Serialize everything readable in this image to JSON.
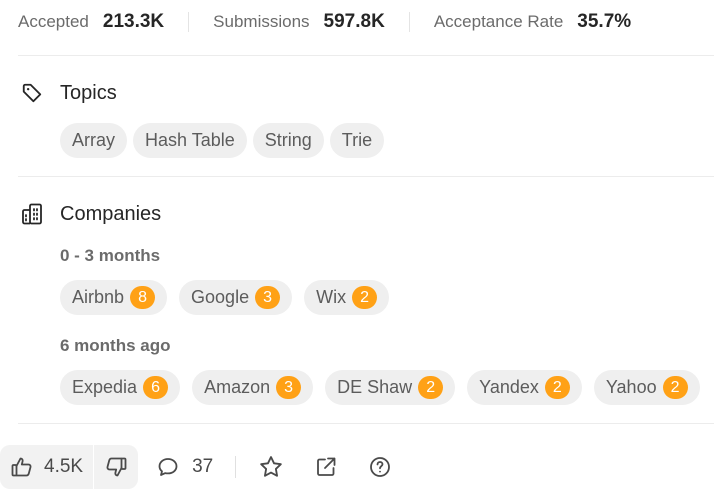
{
  "stats": {
    "accepted_label": "Accepted",
    "accepted_value": "213.3K",
    "submissions_label": "Submissions",
    "submissions_value": "597.8K",
    "rate_label": "Acceptance Rate",
    "rate_value": "35.7%"
  },
  "topics": {
    "title": "Topics",
    "icon": "tag-icon",
    "items": [
      "Array",
      "Hash Table",
      "String",
      "Trie"
    ]
  },
  "companies": {
    "title": "Companies",
    "icon": "building-icon",
    "groups": [
      {
        "period": "0 - 3 months",
        "items": [
          {
            "name": "Airbnb",
            "count": "8"
          },
          {
            "name": "Google",
            "count": "3"
          },
          {
            "name": "Wix",
            "count": "2"
          }
        ]
      },
      {
        "period": "6 months ago",
        "items": [
          {
            "name": "Expedia",
            "count": "6"
          },
          {
            "name": "Amazon",
            "count": "3"
          },
          {
            "name": "DE Shaw",
            "count": "2"
          },
          {
            "name": "Yandex",
            "count": "2"
          },
          {
            "name": "Yahoo",
            "count": "2"
          }
        ]
      }
    ],
    "badge_color": "#ffa116"
  },
  "actions": {
    "likes": "4.5K",
    "comments": "37",
    "like_icon": "thumbs-up-icon",
    "dislike_icon": "thumbs-down-icon",
    "comment_icon": "comment-icon",
    "star_icon": "star-icon",
    "share_icon": "share-icon",
    "help_icon": "help-icon"
  }
}
